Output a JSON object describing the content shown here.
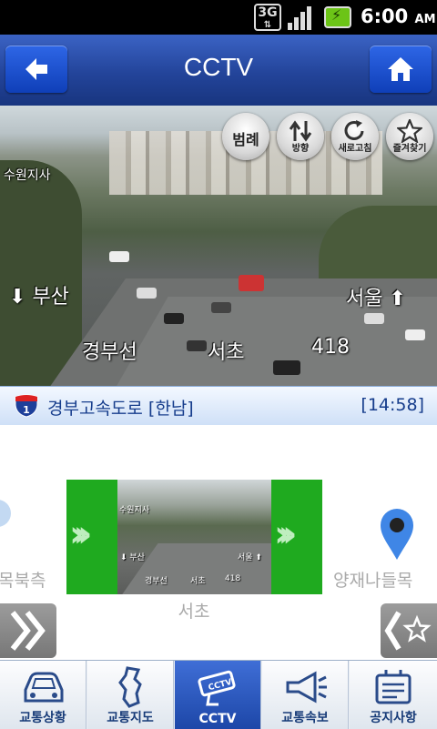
{
  "status_bar": {
    "network": "3G",
    "time": "6:00",
    "ampm": "AM"
  },
  "header": {
    "title": "CCTV"
  },
  "cctv": {
    "overlay_left_direction": "부산",
    "overlay_right_direction": "서울",
    "overlay_road": "경부선",
    "overlay_location": "서초",
    "overlay_km": "418",
    "overlay_branch": "수원지사",
    "buttons": {
      "legend": "범례",
      "direction": "방향",
      "refresh": "새로고침",
      "favorite": "즐겨찾기"
    }
  },
  "road_info": {
    "route_number": "1",
    "name": "경부고속도로 [한남]",
    "time": "[14:58]"
  },
  "carousel": {
    "prev_label": "목북측",
    "current_label": "서초",
    "next_label": "양재나들목",
    "thumb": {
      "branch": "수원지사",
      "left_direction": "부산",
      "right_direction": "서울",
      "road": "경부선",
      "location": "서초",
      "km": "418"
    }
  },
  "tabs": [
    {
      "label": "교통상황",
      "icon": "car-icon"
    },
    {
      "label": "교통지도",
      "icon": "korea-map-icon"
    },
    {
      "label": "CCTV",
      "icon": "cctv-camera-icon"
    },
    {
      "label": "교통속보",
      "icon": "megaphone-icon"
    },
    {
      "label": "공지사항",
      "icon": "notice-board-icon"
    }
  ],
  "colors": {
    "header_blue": "#23449a",
    "accent_green": "#1faa1f",
    "active_tab": "#2b58c0",
    "road_text": "#163d8c"
  }
}
